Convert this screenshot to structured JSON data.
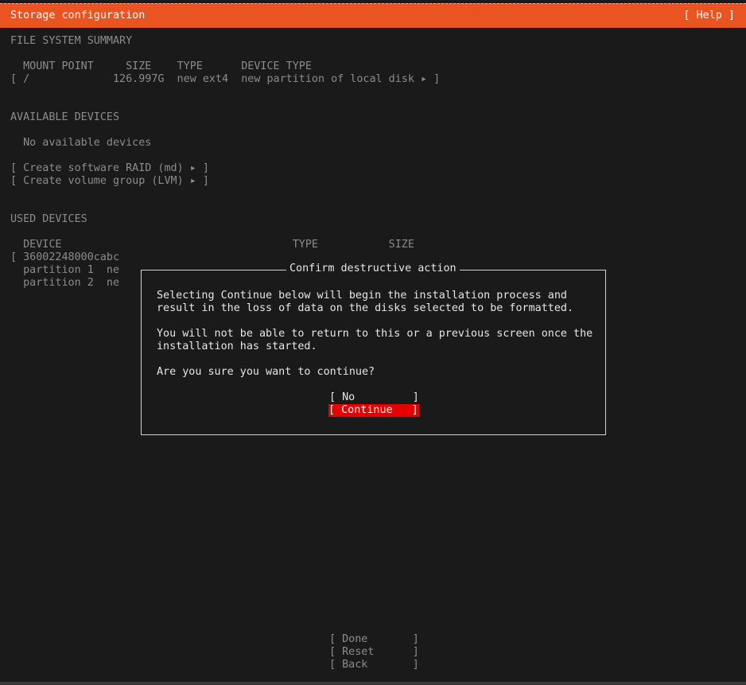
{
  "header": {
    "title": "Storage configuration",
    "help": "[ Help ]"
  },
  "fs_summary": {
    "heading": "FILE SYSTEM SUMMARY",
    "columns": "  MOUNT POINT     SIZE    TYPE      DEVICE TYPE",
    "rows": [
      "[ /             126.997G  new ext4  new partition of local disk ▸ ]"
    ]
  },
  "available": {
    "heading": "AVAILABLE DEVICES",
    "empty_text": "  No available devices",
    "create_raid": "[ Create software RAID (md) ▸ ]",
    "create_lvm": "[ Create volume group (LVM) ▸ ]"
  },
  "used": {
    "heading": "USED DEVICES",
    "columns": "  DEVICE                                    TYPE           SIZE",
    "rows": [
      "[ 36002248000cabc",
      "  partition 1  ne",
      "  partition 2  ne"
    ]
  },
  "dialog": {
    "title": "Confirm destructive action",
    "lines": [
      "Selecting Continue below will begin the installation process and",
      "result in the loss of data on the disks selected to be formatted.",
      "",
      "You will not be able to return to this or a previous screen once the",
      "installation has started.",
      "",
      "Are you sure you want to continue?"
    ],
    "no_button": "[ No         ]",
    "continue_button": "[ Continue   ]"
  },
  "footer": {
    "done": "[ Done       ]",
    "reset": "[ Reset      ]",
    "back": "[ Back       ]"
  },
  "colors": {
    "header_bg": "#e95420",
    "selected_bg": "#e60000",
    "background": "#1a1a1a"
  }
}
